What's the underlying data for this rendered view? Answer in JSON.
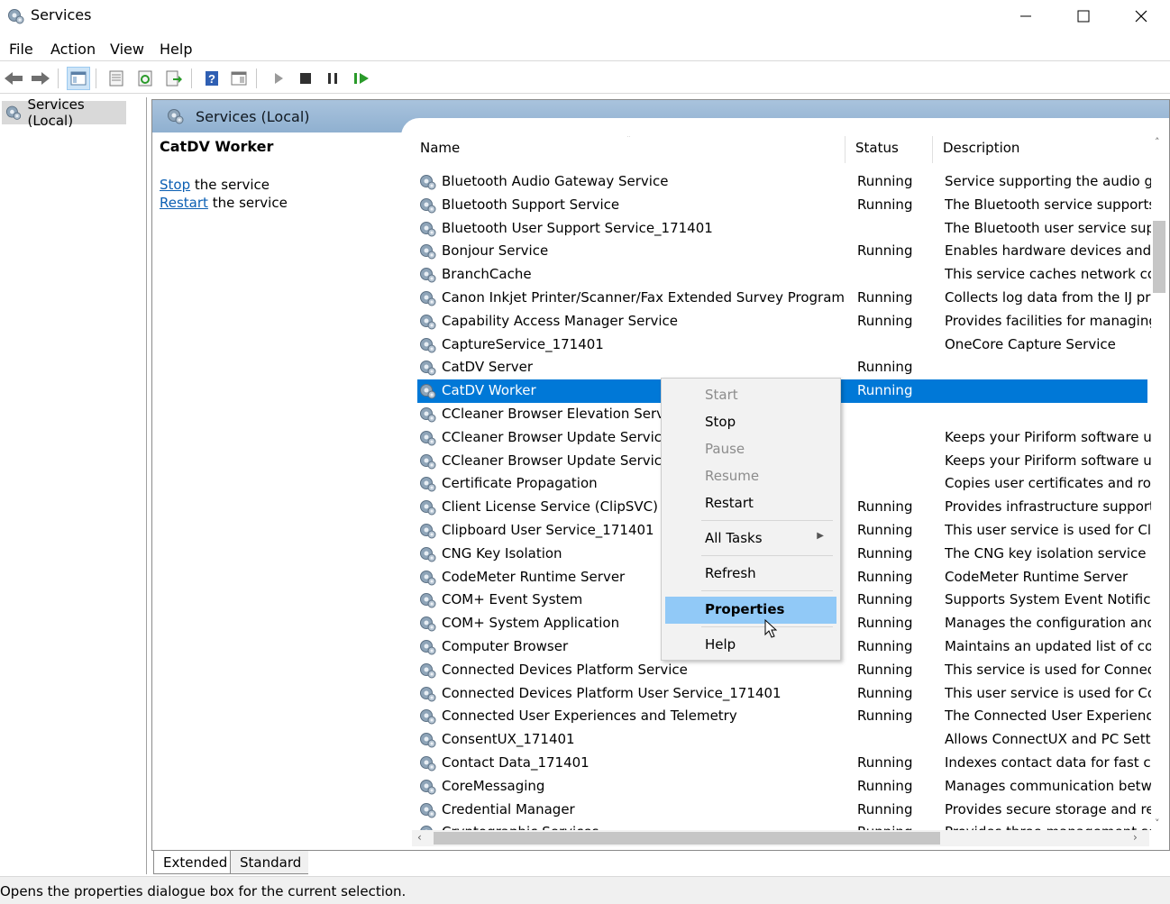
{
  "window": {
    "title": "Services"
  },
  "menu": [
    "File",
    "Action",
    "View",
    "Help"
  ],
  "tree": {
    "root": "Services (Local)"
  },
  "header": {
    "title": "Services (Local)"
  },
  "detail": {
    "service_name": "CatDV Worker",
    "stop_link": "Stop",
    "stop_text": " the service",
    "restart_link": "Restart",
    "restart_text": " the service"
  },
  "columns": {
    "name": "Name",
    "status": "Status",
    "description": "Description"
  },
  "services": [
    {
      "name": "Bluetooth Audio Gateway Service",
      "status": "Running",
      "description": "Service supporting the audio gat"
    },
    {
      "name": "Bluetooth Support Service",
      "status": "Running",
      "description": "The Bluetooth service supports c"
    },
    {
      "name": "Bluetooth User Support Service_171401",
      "status": "",
      "description": "The Bluetooth user service suppo"
    },
    {
      "name": "Bonjour Service",
      "status": "Running",
      "description": "Enables hardware devices and sc"
    },
    {
      "name": "BranchCache",
      "status": "",
      "description": "This service caches network cont"
    },
    {
      "name": "Canon Inkjet Printer/Scanner/Fax Extended Survey Program",
      "status": "Running",
      "description": "Collects log data from the IJ prin"
    },
    {
      "name": "Capability Access Manager Service",
      "status": "Running",
      "description": "Provides facilities for managing U"
    },
    {
      "name": "CaptureService_171401",
      "status": "",
      "description": "OneCore Capture Service"
    },
    {
      "name": "CatDV Server",
      "status": "Running",
      "description": ""
    },
    {
      "name": "CatDV Worker",
      "status": "Running",
      "description": "",
      "selected": true
    },
    {
      "name": "CCleaner Browser Elevation Service",
      "status": "",
      "description": ""
    },
    {
      "name": "CCleaner Browser Update Service (c",
      "status": "",
      "description": "Keeps your Piriform software up"
    },
    {
      "name": "CCleaner Browser Update Service (c",
      "status": "",
      "description": "Keeps your Piriform software up"
    },
    {
      "name": "Certificate Propagation",
      "status": "",
      "description": "Copies user certificates and root"
    },
    {
      "name": "Client License Service (ClipSVC)",
      "status": "Running",
      "description": "Provides infrastructure support f"
    },
    {
      "name": "Clipboard User Service_171401",
      "status": "Running",
      "description": "This user service is used for Clipb"
    },
    {
      "name": "CNG Key Isolation",
      "status": "Running",
      "description": "The CNG key isolation service is"
    },
    {
      "name": "CodeMeter Runtime Server",
      "status": "Running",
      "description": "CodeMeter Runtime Server"
    },
    {
      "name": "COM+ Event System",
      "status": "Running",
      "description": "Supports System Event Notificat"
    },
    {
      "name": "COM+ System Application",
      "status": "Running",
      "description": "Manages the configuration and"
    },
    {
      "name": "Computer Browser",
      "status": "Running",
      "description": "Maintains an updated list of com"
    },
    {
      "name": "Connected Devices Platform Service",
      "status": "Running",
      "description": "This service is used for Connecte"
    },
    {
      "name": "Connected Devices Platform User Service_171401",
      "status": "Running",
      "description": "This user service is used for Conn"
    },
    {
      "name": "Connected User Experiences and Telemetry",
      "status": "Running",
      "description": "The Connected User Experiences"
    },
    {
      "name": "ConsentUX_171401",
      "status": "",
      "description": "Allows ConnectUX and PC Settin"
    },
    {
      "name": "Contact Data_171401",
      "status": "Running",
      "description": "Indexes contact data for fast con"
    },
    {
      "name": "CoreMessaging",
      "status": "Running",
      "description": "Manages communication betwe"
    },
    {
      "name": "Credential Manager",
      "status": "Running",
      "description": "Provides secure storage and retri"
    },
    {
      "name": "Cryptographic Services",
      "status": "Running",
      "description": "Provides three management serv"
    }
  ],
  "context_menu": {
    "start": "Start",
    "stop": "Stop",
    "pause": "Pause",
    "resume": "Resume",
    "restart": "Restart",
    "all_tasks": "All Tasks",
    "refresh": "Refresh",
    "properties": "Properties",
    "help": "Help"
  },
  "tabs": {
    "extended": "Extended",
    "standard": "Standard"
  },
  "status_bar": "Opens the properties dialogue box for the current selection.",
  "colors": {
    "selection": "#0078d7",
    "header": "#9ab8d6",
    "menu_hover": "#91c9f7"
  }
}
